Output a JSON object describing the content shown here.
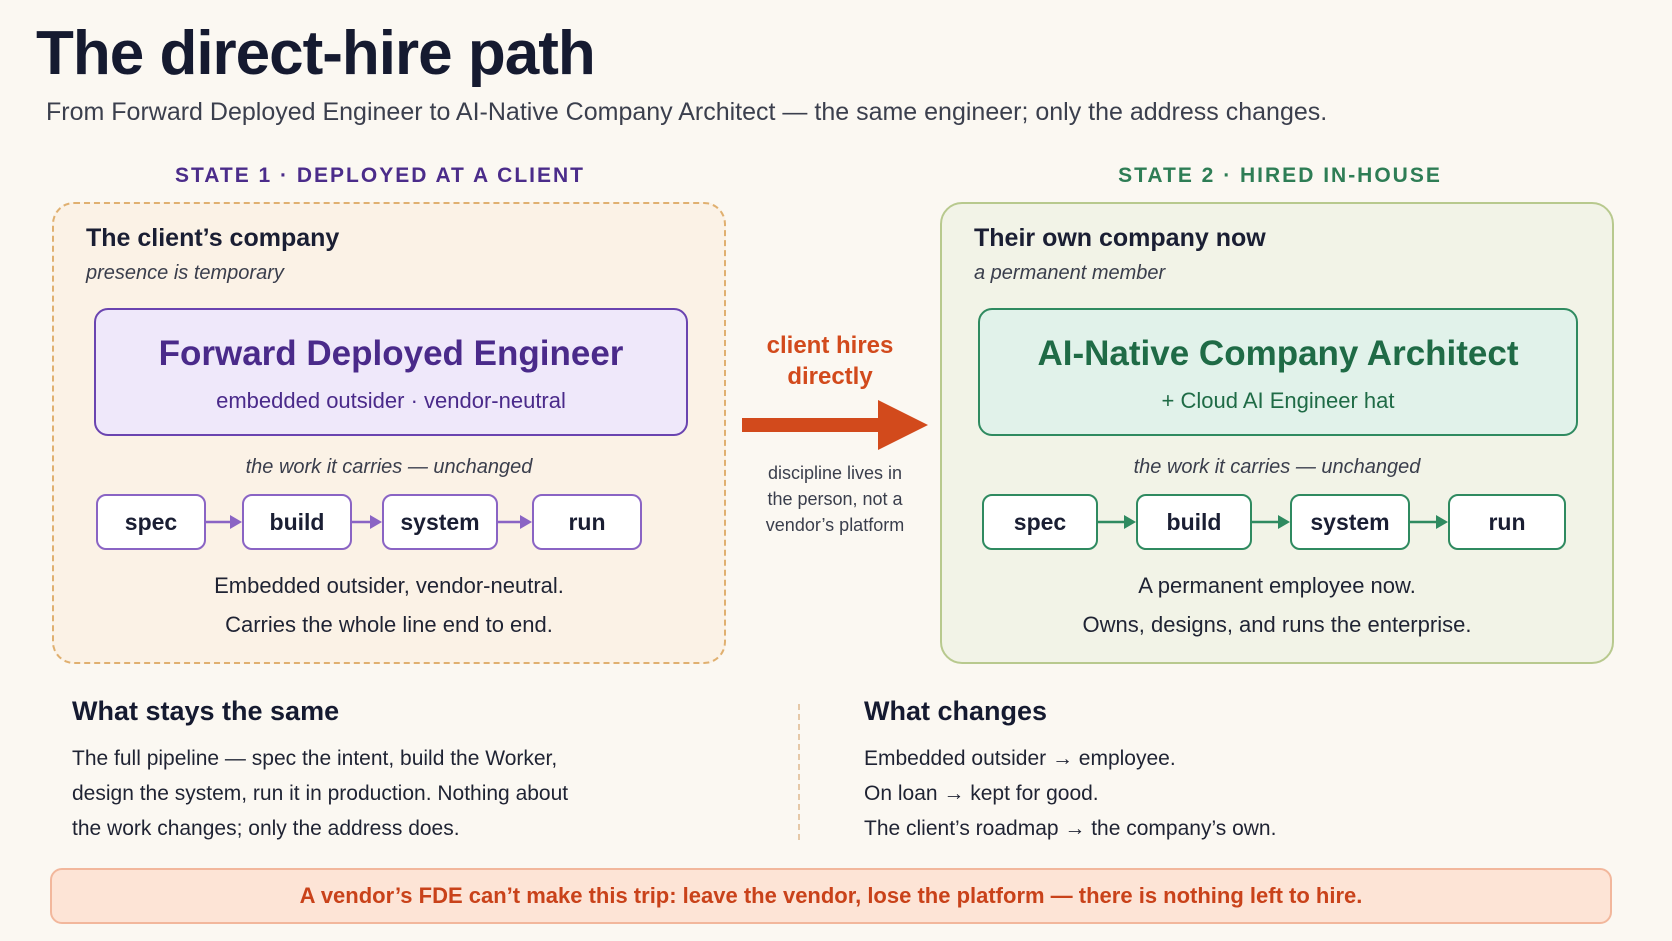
{
  "header": {
    "title": "The direct-hire path",
    "subtitle": "From Forward Deployed Engineer to AI-Native Company Architect — the same engineer; only the address changes."
  },
  "state1": {
    "label": "STATE 1 · DEPLOYED AT A CLIENT",
    "heading": "The client’s company",
    "note": "presence is temporary",
    "role_title": "Forward Deployed Engineer",
    "role_sub": "embedded outsider · vendor-neutral",
    "work_caption": "the work it carries — unchanged",
    "steps": [
      "spec",
      "build",
      "system",
      "run"
    ],
    "desc_line1": "Embedded outsider, vendor-neutral.",
    "desc_line2": "Carries the whole line end to end."
  },
  "transition": {
    "label_line1": "client hires",
    "label_line2": "directly",
    "note_line1": "discipline lives in",
    "note_line2": "the person, not a",
    "note_line3": "vendor’s platform"
  },
  "state2": {
    "label": "STATE 2 · HIRED IN-HOUSE",
    "heading": "Their own company now",
    "note": "a permanent member",
    "role_title": "AI-Native Company Architect",
    "role_sub": "+ Cloud AI Engineer hat",
    "work_caption": "the work it carries — unchanged",
    "steps": [
      "spec",
      "build",
      "system",
      "run"
    ],
    "desc_line1": "A permanent employee now.",
    "desc_line2": "Owns, designs, and runs the enterprise."
  },
  "same": {
    "heading": "What stays the same",
    "lines": [
      "The full pipeline — spec the intent, build the Worker,",
      "design the system, run it in production. Nothing about",
      "the work changes; only the address does."
    ]
  },
  "changes": {
    "heading": "What changes",
    "lines": [
      "Embedded outsider → employee.",
      "On loan → kept for good.",
      "The client’s roadmap → the company’s own."
    ]
  },
  "banner": "A vendor’s FDE can’t make this trip: leave the vendor, lose the platform — there is nothing left to hire.",
  "colors": {
    "state1_accent": "#4b2c8a",
    "state2_accent": "#2e7d55",
    "arrow": "#d24a1c"
  }
}
